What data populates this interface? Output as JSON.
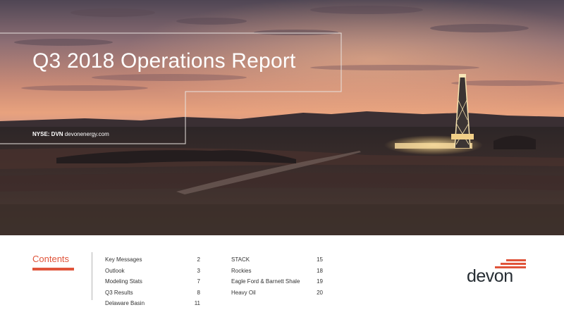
{
  "report": {
    "title": "Q3 2018 Operations Report",
    "ticker_label": "NYSE: DVN",
    "website": "devonenergy.com"
  },
  "contents": {
    "heading": "Contents",
    "left_items": [
      {
        "label": "Key Messages",
        "page": "2"
      },
      {
        "label": "Outlook",
        "page": "3"
      },
      {
        "label": "Modeling Stats",
        "page": "7"
      },
      {
        "label": "Q3 Results",
        "page": "8"
      },
      {
        "label": "Delaware Basin",
        "page": "11"
      }
    ],
    "right_items": [
      {
        "label": "STACK",
        "page": "15"
      },
      {
        "label": "Rockies",
        "page": "18"
      },
      {
        "label": "Eagle Ford & Barnett Shale",
        "page": "19"
      },
      {
        "label": "Heavy Oil",
        "page": "20"
      }
    ]
  },
  "logo": {
    "text": "devon"
  },
  "colors": {
    "accent": "#e0543a",
    "logo_text": "#262d33",
    "body_text": "#333333"
  },
  "icons": [
    "drilling-rig-image",
    "devon-logo-mark"
  ]
}
